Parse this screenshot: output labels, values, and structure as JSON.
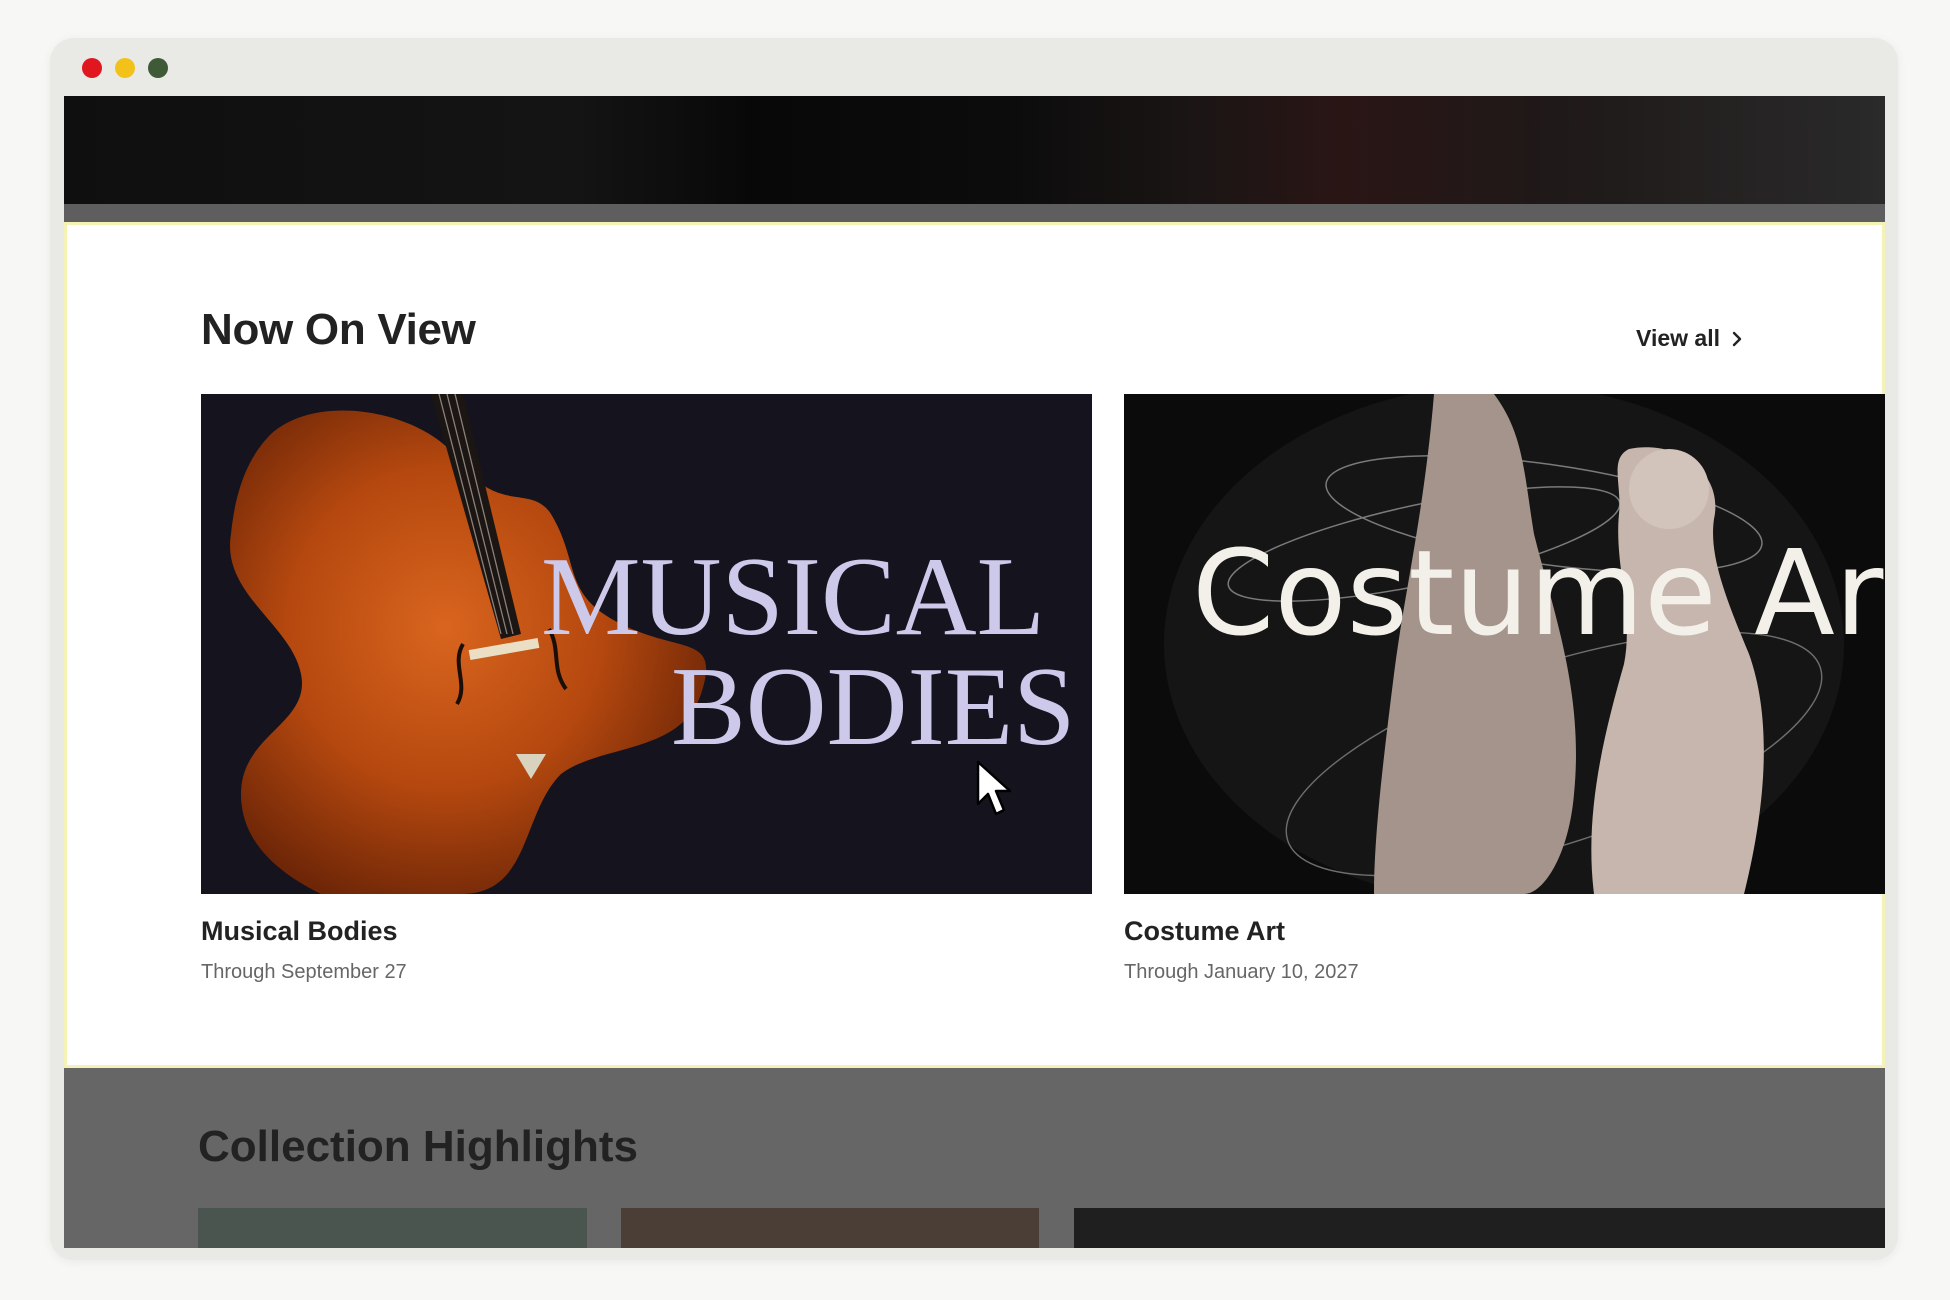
{
  "window": {
    "traffic_lights": {
      "close": "#e0171e",
      "minimize": "#f2c21b",
      "zoom": "#3f5a37"
    }
  },
  "now_on_view": {
    "title": "Now On View",
    "view_all_label": "View all",
    "cards": [
      {
        "title": "Musical Bodies",
        "subtitle": "Through September 27",
        "image_text_line1": "MUSICAL",
        "image_text_line2": "BODIES"
      },
      {
        "title": "Costume Art",
        "subtitle": "Through January 10, 2027",
        "image_text": "Costume Art"
      }
    ]
  },
  "collection_highlights": {
    "title": "Collection Highlights"
  },
  "icons": [
    "chevron-right-icon",
    "mouse-cursor-icon"
  ],
  "colors": {
    "panel_highlight_border": "#f5f2b5",
    "overlay": "#666666"
  }
}
